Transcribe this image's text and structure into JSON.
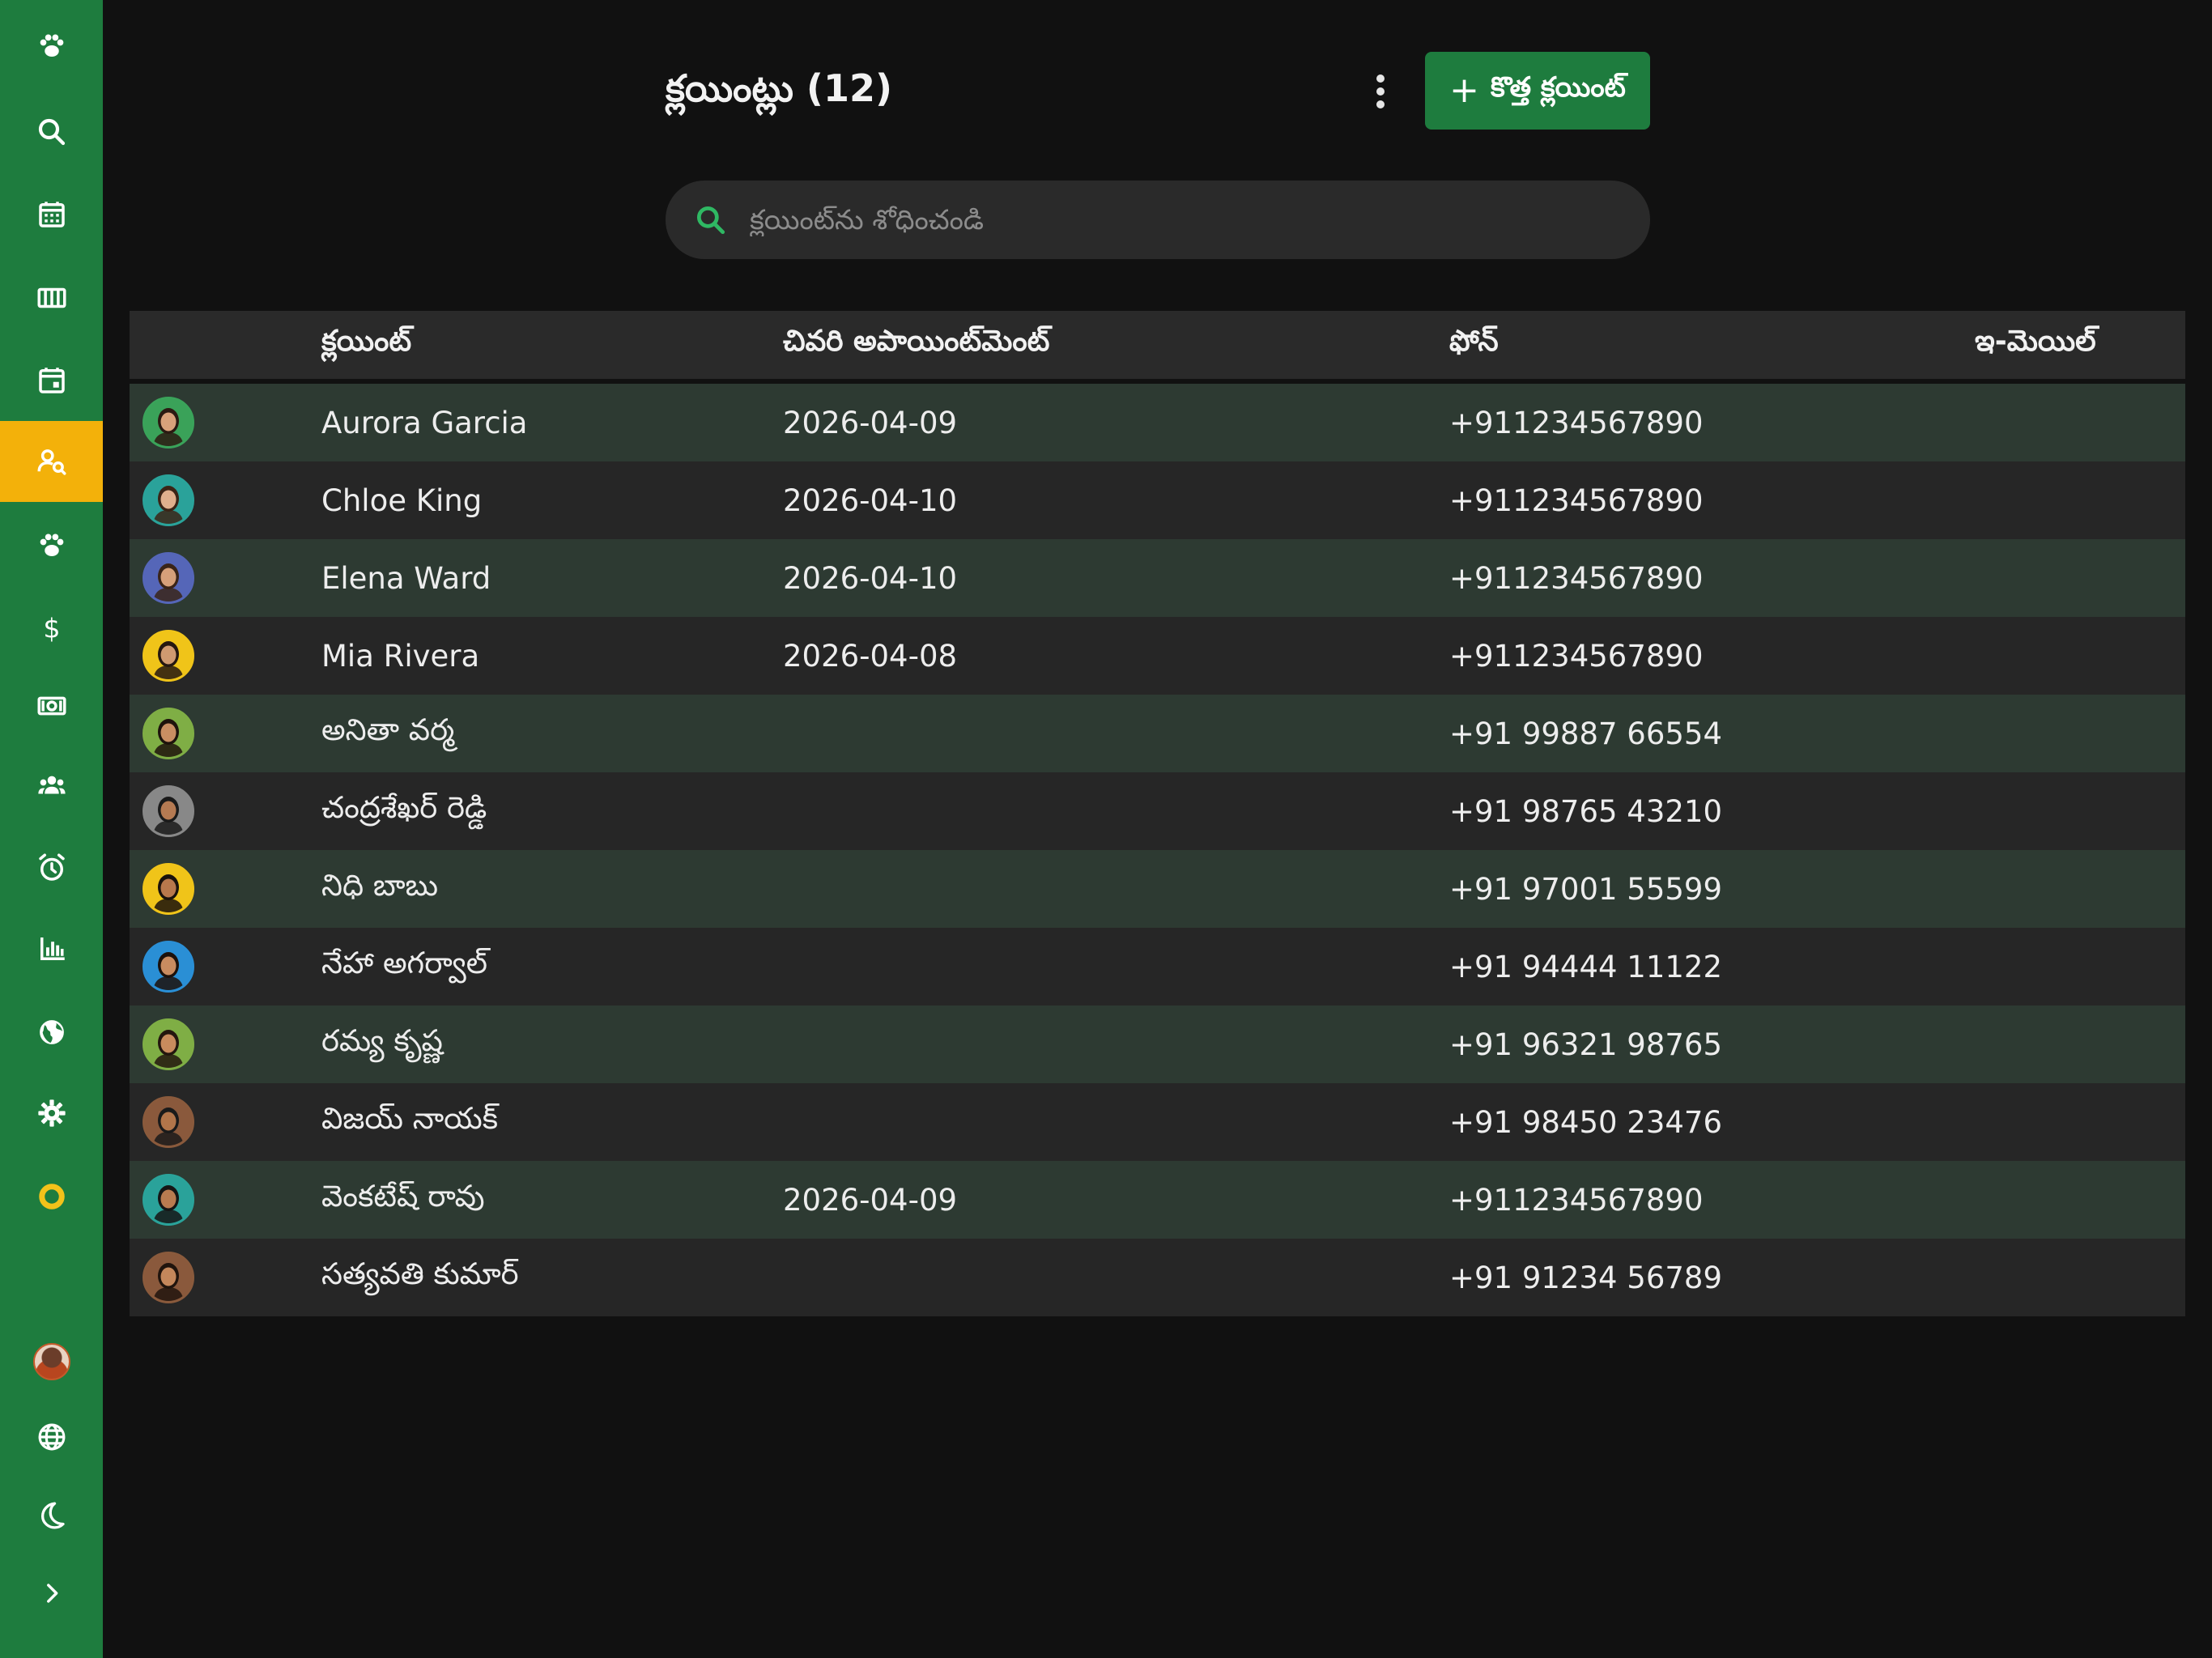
{
  "sidebar": {
    "items": [
      {
        "icon": "paw-icon"
      },
      {
        "icon": "search-icon"
      },
      {
        "icon": "calendar-icon"
      },
      {
        "icon": "columns-icon"
      },
      {
        "icon": "calendar-day-icon"
      },
      {
        "icon": "client-search-icon",
        "active": true
      },
      {
        "icon": "paw-icon"
      },
      {
        "icon": "dollar-icon"
      },
      {
        "icon": "cash-icon"
      },
      {
        "icon": "users-icon"
      },
      {
        "icon": "alarm-icon"
      },
      {
        "icon": "chart-icon"
      },
      {
        "icon": "globe-europe-icon"
      },
      {
        "icon": "gear-icon"
      },
      {
        "icon": "ring-icon"
      }
    ],
    "bottom": [
      {
        "icon": "user-avatar"
      },
      {
        "icon": "language-icon"
      },
      {
        "icon": "moon-icon"
      },
      {
        "icon": "chevron-right-icon"
      }
    ],
    "colors": {
      "background": "#1e7c3e",
      "active": "#f3b10a"
    }
  },
  "header": {
    "title": "క్లయింట్లు (12)",
    "add_button_label": "కొత్త క్లయింట్"
  },
  "search": {
    "placeholder": "క్లయింట్‌ను శోధించండి",
    "value": ""
  },
  "table": {
    "columns": [
      "క్లయింట్",
      "చివరి అపాయింట్‌మెంట్",
      "ఫోన్",
      "ఇ-మెయిల్"
    ],
    "rows": [
      {
        "name": "Aurora Garcia",
        "last_appointment": "2026-04-09",
        "phone": "+911234567890",
        "email": "",
        "ring": "#3aa35a",
        "skin": "#d9a27b",
        "hair": "#2b1a12"
      },
      {
        "name": "Chloe King",
        "last_appointment": "2026-04-10",
        "phone": "+911234567890",
        "email": "",
        "ring": "#2aa39a",
        "skin": "#e0b08d",
        "hair": "#3b2416"
      },
      {
        "name": "Elena Ward",
        "last_appointment": "2026-04-10",
        "phone": "+911234567890",
        "email": "",
        "ring": "#5566b8",
        "skin": "#d6a07a",
        "hair": "#3a2418"
      },
      {
        "name": "Mia Rivera",
        "last_appointment": "2026-04-08",
        "phone": "+911234567890",
        "email": "",
        "ring": "#f0c419",
        "skin": "#d09a70",
        "hair": "#251710"
      },
      {
        "name": "అనితా వర్మ",
        "last_appointment": "",
        "phone": "+91 99887 66554",
        "email": "",
        "ring": "#7fae45",
        "skin": "#c98e62",
        "hair": "#1e130c"
      },
      {
        "name": "చంద్రశేఖర్ రెడ్డి",
        "last_appointment": "",
        "phone": "+91 98765 43210",
        "email": "",
        "ring": "#888888",
        "skin": "#b57a52",
        "hair": "#1a1a1a"
      },
      {
        "name": "నిధి బాబు",
        "last_appointment": "",
        "phone": "+91 97001 55599",
        "email": "",
        "ring": "#f0c419",
        "skin": "#b8784c",
        "hair": "#1a120c"
      },
      {
        "name": "నేహా అగర్వాల్",
        "last_appointment": "",
        "phone": "+91 94444 11122",
        "email": "",
        "ring": "#2a8fd6",
        "skin": "#c98c60",
        "hair": "#1c110b"
      },
      {
        "name": "రమ్య కృష్ణ",
        "last_appointment": "",
        "phone": "+91 96321 98765",
        "email": "",
        "ring": "#7fae45",
        "skin": "#c88b5d",
        "hair": "#23160e"
      },
      {
        "name": "విజయ్ నాయక్",
        "last_appointment": "",
        "phone": "+91 98450 23476",
        "email": "",
        "ring": "#8a5a3c",
        "skin": "#b2754a",
        "hair": "#1a1a1a"
      },
      {
        "name": "వెంకటేష్ రావు",
        "last_appointment": "2026-04-09",
        "phone": "+911234567890",
        "email": "",
        "ring": "#2aa39a",
        "skin": "#b97b50",
        "hair": "#151515"
      },
      {
        "name": "సత్యవతి కుమార్",
        "last_appointment": "",
        "phone": "+91 91234 56789",
        "email": "",
        "ring": "#8a5a3c",
        "skin": "#c4875b",
        "hair": "#20140d"
      }
    ]
  },
  "colors": {
    "accent": "#1e7c3e",
    "highlight": "#f3b10a",
    "background": "#111111",
    "row_alt": "#2d3a32",
    "row": "#262626"
  }
}
